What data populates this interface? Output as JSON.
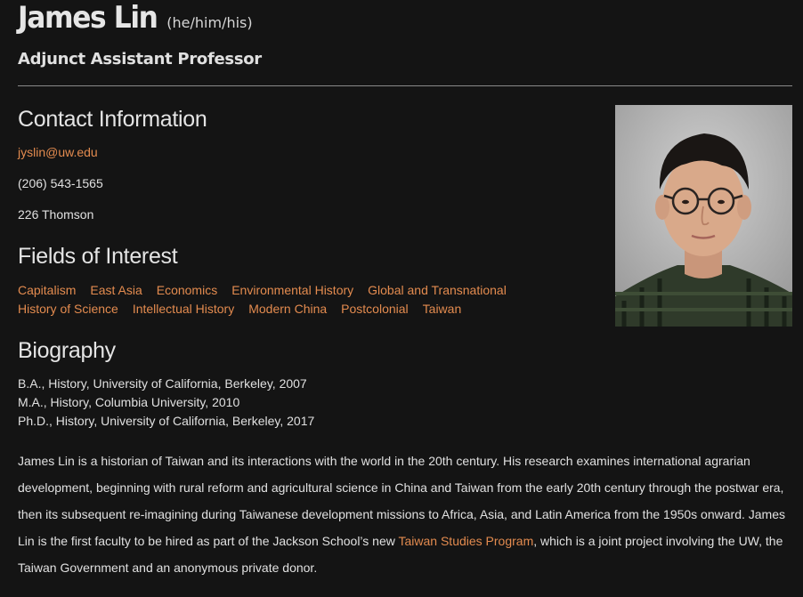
{
  "header": {
    "name": "James Lin",
    "pronouns": "(he/him/his)",
    "title": "Adjunct Assistant Professor"
  },
  "contact": {
    "heading": "Contact Information",
    "email": "jyslin@uw.edu",
    "phone": "(206) 543-1565",
    "office": "226 Thomson"
  },
  "fields": {
    "heading": "Fields of Interest",
    "items": [
      "Capitalism",
      "East Asia",
      "Economics",
      "Environmental History",
      "Global and Transnational",
      "History of Science",
      "Intellectual History",
      "Modern China",
      "Postcolonial",
      "Taiwan"
    ]
  },
  "biography": {
    "heading": "Biography",
    "education": [
      "B.A., History, University of California, Berkeley, 2007",
      "M.A., History, Columbia University, 2010",
      "Ph.D., History, University of California, Berkeley, 2017"
    ],
    "text_before_link": "James Lin is a historian of Taiwan and its interactions with the world in the 20th century. His research examines international agrarian development, beginning with rural reform and agricultural science in China and Taiwan from the early 20th century through the postwar era, then its subsequent re-imagining during Taiwanese development missions to Africa, Asia, and Latin America from the 1950s onward. James Lin is the first faculty to be hired as part of the Jackson School’s new ",
    "link_text": "Taiwan Studies Program",
    "text_after_link": ", which is a joint project involving the UW, the Taiwan Government and an anonymous private donor."
  },
  "colors": {
    "background": "#141414",
    "link": "#e38b4f",
    "text": "#e0e0e0"
  },
  "photo": {
    "icon": "portrait-photo"
  }
}
